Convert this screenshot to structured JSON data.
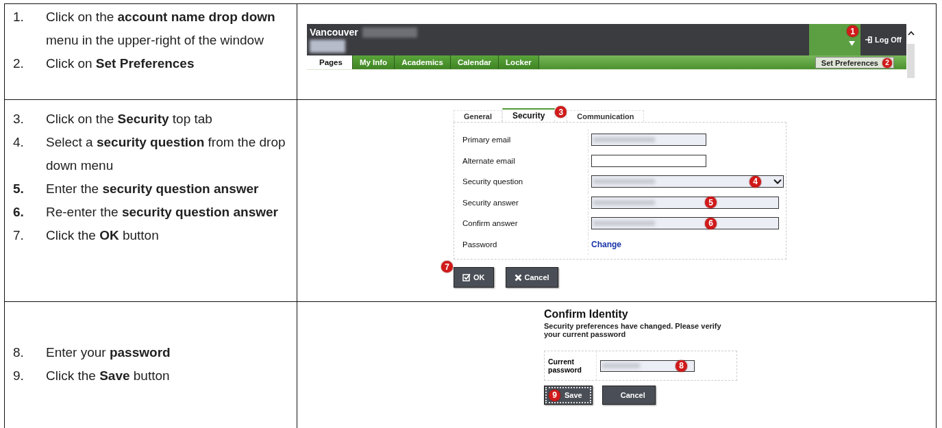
{
  "rows": [
    {
      "steps": [
        {
          "number": "1.",
          "number_bold": false,
          "text": "Click on the **account name drop down** menu in the upper-right of the window"
        },
        {
          "number": "2.",
          "number_bold": false,
          "text": "Click on **Set Preferences**"
        }
      ],
      "screen": {
        "kind": "header",
        "site_title": "Vancouver",
        "account_badge": "1",
        "logoff": "Log Off",
        "tabs": [
          {
            "label": "Pages",
            "selected": true
          },
          {
            "label": "My Info",
            "selected": false
          },
          {
            "label": "Academics",
            "selected": false
          },
          {
            "label": "Calendar",
            "selected": false
          },
          {
            "label": "Locker",
            "selected": false
          }
        ],
        "menu_item": {
          "label": "Set Preferences",
          "badge": "2"
        }
      }
    },
    {
      "steps": [
        {
          "number": "3.",
          "number_bold": false,
          "text": "Click on the **Security** top tab"
        },
        {
          "number": "4.",
          "number_bold": false,
          "text": "Select a **security question** from the drop down menu"
        },
        {
          "number": "5.",
          "number_bold": true,
          "text": "Enter the **security question answer**"
        },
        {
          "number": "6.",
          "number_bold": true,
          "text": "Re-enter the **security question answer**"
        },
        {
          "number": "7.",
          "number_bold": false,
          "text": "Click the **OK** button"
        }
      ],
      "screen": {
        "kind": "preferences",
        "tabs": [
          {
            "label": "General",
            "selected": false
          },
          {
            "label": "Security",
            "selected": true,
            "badge": "3"
          },
          {
            "label": "Communication",
            "selected": false
          }
        ],
        "fields": [
          {
            "label": "Primary email",
            "kind": "email",
            "redacted": true
          },
          {
            "label": "Alternate email",
            "kind": "email",
            "redacted": false
          },
          {
            "label": "Security question",
            "kind": "select",
            "redacted": true,
            "badge": "4"
          },
          {
            "label": "Security answer",
            "kind": "answer",
            "redacted": true,
            "badge": "5"
          },
          {
            "label": "Confirm answer",
            "kind": "answer",
            "redacted": true,
            "badge": "6"
          },
          {
            "label": "Password",
            "kind": "link",
            "link": "Change"
          }
        ],
        "buttons": [
          {
            "label": "OK",
            "kind": "ok",
            "badge": "7"
          },
          {
            "label": "Cancel",
            "kind": "cancel"
          }
        ]
      }
    },
    {
      "steps": [
        {
          "number": "8.",
          "number_bold": false,
          "text": "Enter your **password**"
        },
        {
          "number": "9.",
          "number_bold": false,
          "text": "Click the **Save** button"
        }
      ],
      "screen": {
        "kind": "confirm",
        "title": "Confirm Identity",
        "message": "Security preferences have changed. Please verify your current password",
        "field": {
          "label": "Current password",
          "redacted": true,
          "badge": "8"
        },
        "buttons": [
          {
            "label": "Save",
            "focused": true,
            "badge": "9"
          },
          {
            "label": "Cancel",
            "focused": false
          }
        ]
      }
    }
  ]
}
